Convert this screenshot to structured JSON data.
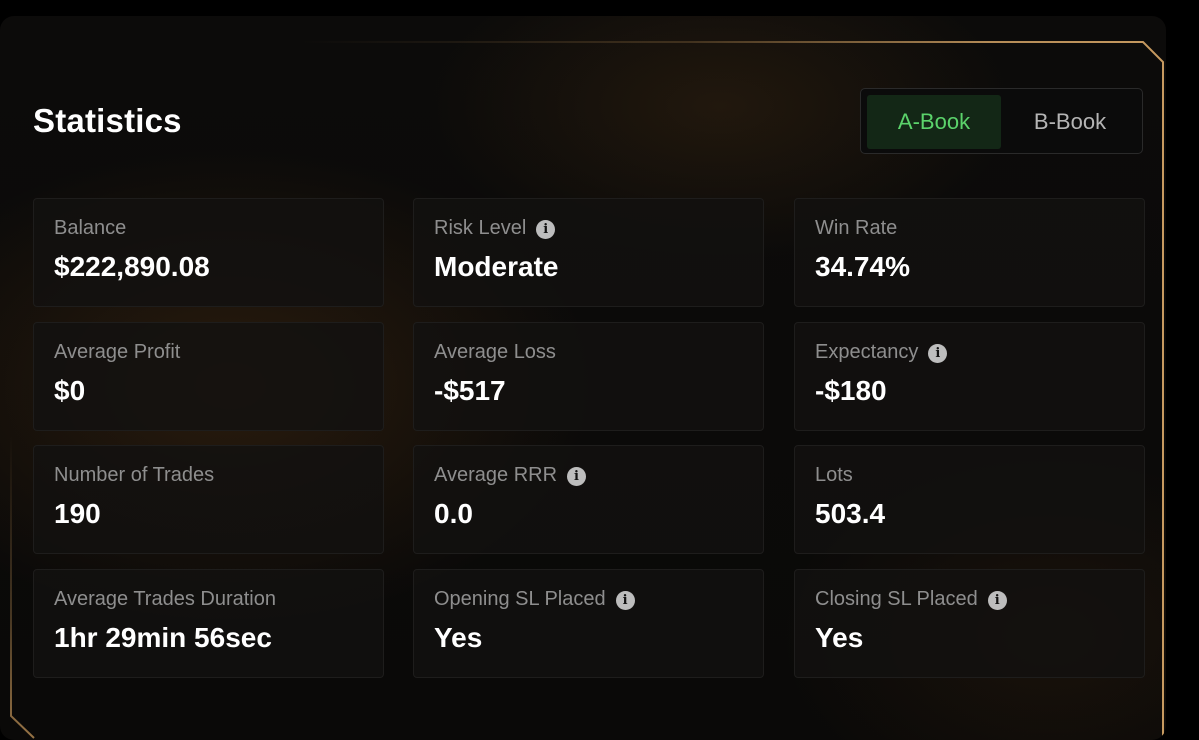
{
  "header": {
    "title": "Statistics"
  },
  "book_toggle": {
    "options": [
      "A-Book",
      "B-Book"
    ],
    "selected": "A-Book"
  },
  "stats": [
    {
      "label": "Balance",
      "value": "$222,890.08",
      "info": false
    },
    {
      "label": "Risk Level",
      "value": "Moderate",
      "info": true
    },
    {
      "label": "Win Rate",
      "value": "34.74%",
      "info": false
    },
    {
      "label": "Average Profit",
      "value": "$0",
      "info": false
    },
    {
      "label": "Average Loss",
      "value": "-$517",
      "info": false
    },
    {
      "label": "Expectancy",
      "value": "-$180",
      "info": true
    },
    {
      "label": "Number of Trades",
      "value": "190",
      "info": false
    },
    {
      "label": "Average RRR",
      "value": "0.0",
      "info": true
    },
    {
      "label": "Lots",
      "value": "503.4",
      "info": false
    },
    {
      "label": "Average Trades Duration",
      "value": "1hr 29min 56sec",
      "info": false
    },
    {
      "label": "Opening SL Placed",
      "value": "Yes",
      "info": true
    },
    {
      "label": "Closing SL Placed",
      "value": "Yes",
      "info": true
    }
  ],
  "icons": {
    "info": "info-icon"
  },
  "colors": {
    "background": "#0a0908",
    "accent_green": "#5bd36b",
    "toggle_active_bg": "#132716",
    "border_gold": "#b98d54",
    "label": "#8e8e8e",
    "value": "#ffffff"
  }
}
